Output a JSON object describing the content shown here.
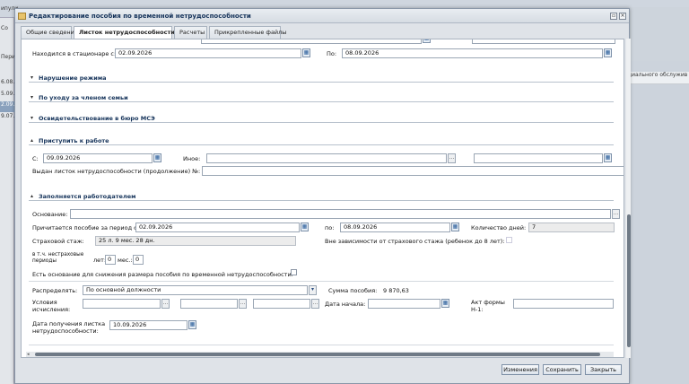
{
  "background": {
    "top_label": "ипули",
    "rows": [
      "Со",
      "Перис",
      "6.08.",
      "5.09.",
      "2.09.",
      "9.07."
    ],
    "right_text": "циального обслужив"
  },
  "dialog": {
    "title": "Редактирование пособия по временной нетрудоспособности",
    "tabs": [
      "Общие сведения",
      "Листок нетрудоспособности",
      "Расчеты",
      "Прикрепленные файлы"
    ],
    "active_tab": 1
  },
  "hospital": {
    "from_label": "Находился в стационаре с:",
    "from_value": "02.09.2026",
    "to_label": "По:",
    "to_value": "08.09.2026"
  },
  "sections": {
    "violation": "Нарушение режима",
    "care": "По уходу за членом семьи",
    "mse": "Освидетельствование в бюро МСЭ",
    "start_work": "Приступить к работе",
    "employer": "Заполняется работодателем"
  },
  "start_work": {
    "from_label": "С:",
    "from_value": "09.09.2026",
    "other_label": "Иное:",
    "other_value": "",
    "extra_value": "",
    "continuation_label": "Выдан листок нетрудоспособности (продолжение) №:",
    "continuation_value": ""
  },
  "employer": {
    "basis_label": "Основание:",
    "basis_value": "",
    "period_label": "Причитается пособие за период с:",
    "period_from": "02.09.2026",
    "period_to_label": "по:",
    "period_to": "08.09.2026",
    "days_label": "Количество дней:",
    "days_value": "7",
    "stazh_label": "Страховой стаж:",
    "stazh_value": "25 л. 9 мес. 28 дн.",
    "independent_label": "Вне зависимости от страхового стажа (ребенок до 8 лет):",
    "nonins_label": "в т.ч. нестраховые периоды",
    "years_label": "лет:",
    "years_value": "0",
    "months_label": "мес.:",
    "months_value": "0",
    "reduce_label": "Есть основание для снижения размера пособия по временной нетрудоспособности:",
    "distribute_label": "Распределять:",
    "distribute_value": "По основной должности",
    "sum_label": "Сумма пособия:",
    "sum_value": "9 870,63",
    "conditions_label": "Условия исчисления:",
    "cond1": "",
    "cond2": "",
    "cond3": "",
    "start_date_label": "Дата начала:",
    "start_date_value": "",
    "act_label": "Акт формы Н-1:",
    "act_value": "",
    "receive_label": "Дата получения листка нетрудоспособности:",
    "receive_value": "10.09.2026"
  },
  "buttons": {
    "changes": "Изменения",
    "save": "Сохранить",
    "close": "Закрыть"
  },
  "icons": {
    "calendar": "calendar-icon",
    "ellipsis": "ellipsis-icon",
    "collapse": "collapse-arrow-icon",
    "dropdown": "chevron-down-icon"
  }
}
